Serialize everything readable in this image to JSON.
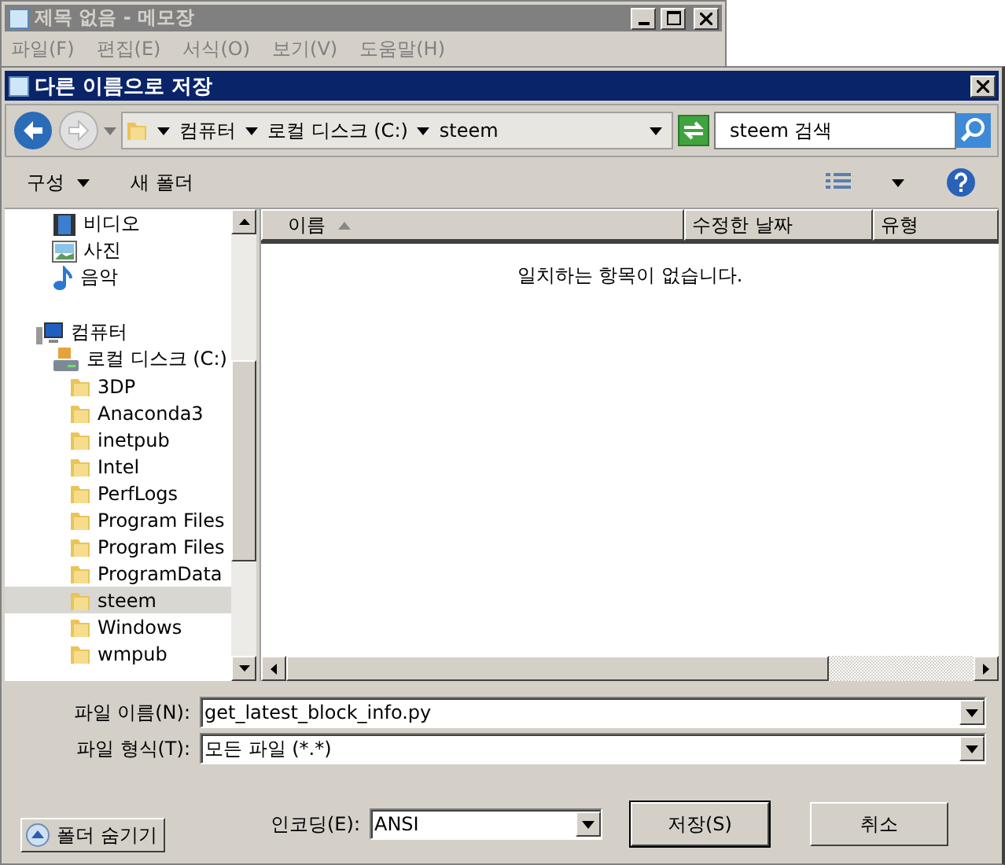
{
  "notepad": {
    "title": "제목 없음 - 메모장",
    "menu": [
      "파일(F)",
      "편집(E)",
      "서식(O)",
      "보기(V)",
      "도움말(H)"
    ]
  },
  "dialog": {
    "title": "다른 이름으로 저장",
    "breadcrumbs": [
      "컴퓨터",
      "로컬 디스크 (C:)",
      "steem"
    ],
    "search": {
      "placeholder": "steem 검색"
    },
    "toolbar": [
      "구성",
      "새 폴더"
    ],
    "tree": [
      {
        "label": "비디오",
        "kind": "video",
        "selected": false
      },
      {
        "label": "사진",
        "kind": "photo",
        "selected": false
      },
      {
        "label": "음악",
        "kind": "music",
        "selected": false
      },
      {
        "label": "컴퓨터",
        "kind": "computer",
        "selected": false,
        "children": [
          {
            "label": "로컬 디스크 (C:)",
            "kind": "drive",
            "selected": false,
            "children": [
              {
                "label": "3DP",
                "kind": "folder",
                "selected": false
              },
              {
                "label": "Anaconda3",
                "kind": "folder",
                "selected": false
              },
              {
                "label": "inetpub",
                "kind": "folder",
                "selected": false
              },
              {
                "label": "Intel",
                "kind": "folder",
                "selected": false
              },
              {
                "label": "PerfLogs",
                "kind": "folder",
                "selected": false
              },
              {
                "label": "Program Files",
                "kind": "folder",
                "selected": false
              },
              {
                "label": "Program Files",
                "kind": "folder",
                "selected": false
              },
              {
                "label": "ProgramData",
                "kind": "folder",
                "selected": false
              },
              {
                "label": "steem",
                "kind": "folder",
                "selected": true
              },
              {
                "label": "Windows",
                "kind": "folder",
                "selected": false
              },
              {
                "label": "wmpub",
                "kind": "folder",
                "selected": false
              }
            ]
          }
        ]
      }
    ],
    "columns": [
      {
        "label": "이름",
        "sorted": true
      },
      {
        "label": "수정한 날짜",
        "sorted": false
      },
      {
        "label": "유형",
        "sorted": false
      }
    ],
    "empty_message": "일치하는 항목이 없습니다.",
    "file_name": {
      "label": "파일 이름(N):",
      "value": "get_latest_block_info.py"
    },
    "file_type": {
      "label": "파일 형식(T):",
      "value": "모든 파일 (*.*)"
    },
    "hide_folders": "폴더 숨기기",
    "encoding": {
      "label": "인코딩(E):",
      "value": "ANSI"
    },
    "buttons": [
      "저장(S)",
      "취소"
    ]
  }
}
